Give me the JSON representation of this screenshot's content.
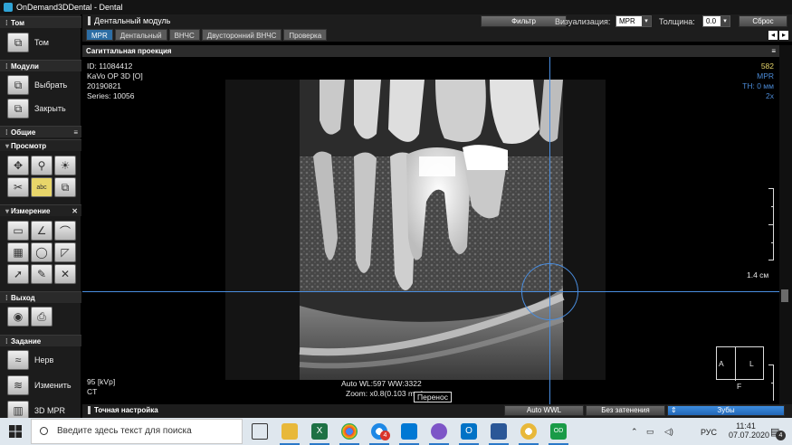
{
  "window": {
    "title": "OnDemand3DDental - Dental"
  },
  "sidebar": {
    "sections": {
      "tom": {
        "title": "Том",
        "button": "Том"
      },
      "modules": {
        "title": "Модули",
        "buttons": [
          "Выбрать",
          "Закрыть"
        ]
      },
      "common": {
        "title": "Общие"
      },
      "view": {
        "title": "Просмотр"
      },
      "measure": {
        "title": "Измерение"
      },
      "exit": {
        "title": "Выход"
      },
      "task": {
        "title": "Задание",
        "buttons": [
          "Нерв",
          "Изменить",
          "3D MPR"
        ]
      }
    }
  },
  "header": {
    "module": "Дентальный модуль",
    "filter_button": "Фильтр",
    "vis_label": "Визуализация:",
    "vis_value": "MPR",
    "thickness_label": "Толщина:",
    "thickness_value": "0.0",
    "reset_button": "Сброс"
  },
  "tabs": [
    "MPR",
    "Дентальный",
    "ВНЧС",
    "Двусторонний ВНЧС",
    "Проверка"
  ],
  "view": {
    "title": "Сагиттальная проекция",
    "top_left": [
      "ID: 11084412",
      "KaVo OP 3D [O]",
      "20190821",
      "Series: 10056"
    ],
    "top_right": [
      "582",
      "MPR",
      "TH: 0 мм",
      "2x"
    ],
    "scale_label": "1.4 см",
    "bottom_left": [
      "95 [kVp]",
      "CT"
    ],
    "bottom_center": [
      "Auto WL:597 WW:3322",
      "Zoom: x0.8(0.103 mm)"
    ],
    "tooltip": "Перенос",
    "orientation": {
      "left": "A",
      "right": "L",
      "bottom": "F"
    }
  },
  "finebar": {
    "title": "Точная настройка",
    "auto_wwl": "Auto WWL",
    "no_shade": "Без затенения",
    "teeth": "Зубы"
  },
  "taskbar": {
    "search_placeholder": "Введите здесь текст для поиска",
    "lang": "РУС",
    "time": "11:41",
    "date": "07.07.2020",
    "notif_count": "4",
    "badge_count": "4"
  },
  "colors": {
    "accent": "#2d6ea5",
    "crosshair": "#4a8ee0",
    "overlay_right": "#4b8ad6"
  }
}
